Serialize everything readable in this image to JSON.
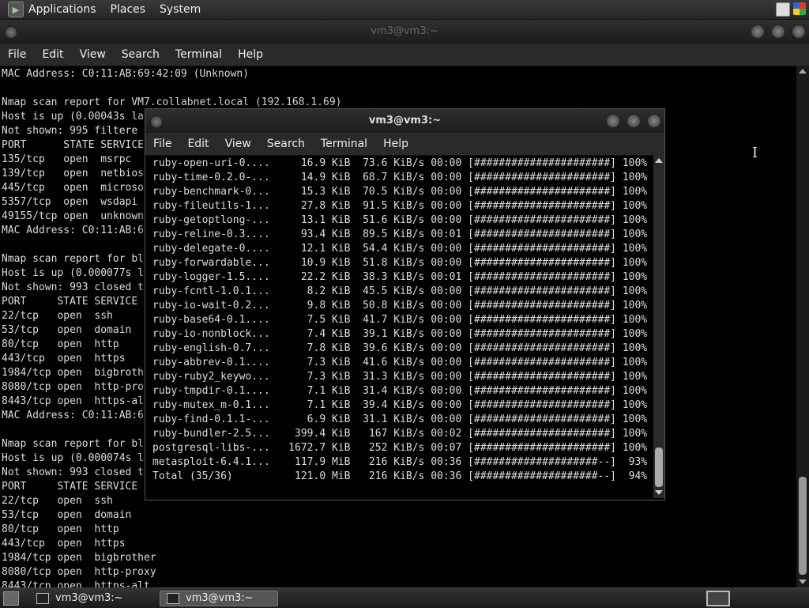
{
  "top_panel": {
    "menus": [
      "Applications",
      "Places",
      "System"
    ]
  },
  "back_window": {
    "title": "vm3@vm3:~",
    "menu": [
      "File",
      "Edit",
      "View",
      "Search",
      "Terminal",
      "Help"
    ],
    "lines": [
      "MAC Address: C0:11:AB:69:42:09 (Unknown)",
      "",
      "Nmap scan report for VM7.collabnet.local (192.168.1.69)",
      "Host is up (0.00043s la",
      "Not shown: 995 filtere",
      "PORT      STATE SERVICE",
      "135/tcp   open  msrpc",
      "139/tcp   open  netbios",
      "445/tcp   open  microso",
      "5357/tcp  open  wsdapi",
      "49155/tcp open  unknown",
      "MAC Address: C0:11:AB:6",
      "",
      "Nmap scan report for bl",
      "Host is up (0.000077s l",
      "Not shown: 993 closed t",
      "PORT     STATE SERVICE",
      "22/tcp   open  ssh",
      "53/tcp   open  domain",
      "80/tcp   open  http",
      "443/tcp  open  https",
      "1984/tcp open  bigbroth",
      "8080/tcp open  http-pro",
      "8443/tcp open  https-al",
      "MAC Address: C0:11:AB:6",
      "",
      "Nmap scan report for bl",
      "Host is up (0.000074s l",
      "Not shown: 993 closed t",
      "PORT     STATE SERVICE",
      "22/tcp   open  ssh",
      "53/tcp   open  domain",
      "80/tcp   open  http",
      "443/tcp  open  https",
      "1984/tcp open  bigbrother",
      "8080/tcp open  http-proxy",
      "8443/tcp open  https-alt"
    ]
  },
  "front_window": {
    "title": "vm3@vm3:~",
    "menu": [
      "File",
      "Edit",
      "View",
      "Search",
      "Terminal",
      "Help"
    ],
    "lines": [
      "ruby-open-uri-0....     16.9 KiB  73.6 KiB/s 00:00 [######################] 100%",
      "ruby-time-0.2.0-...     14.9 KiB  68.7 KiB/s 00:00 [######################] 100%",
      "ruby-benchmark-0...     15.3 KiB  70.5 KiB/s 00:00 [######################] 100%",
      "ruby-fileutils-1...     27.8 KiB  91.5 KiB/s 00:00 [######################] 100%",
      "ruby-getoptlong-...     13.1 KiB  51.6 KiB/s 00:00 [######################] 100%",
      "ruby-reline-0.3....     93.4 KiB  89.5 KiB/s 00:01 [######################] 100%",
      "ruby-delegate-0....     12.1 KiB  54.4 KiB/s 00:00 [######################] 100%",
      "ruby-forwardable...     10.9 KiB  51.8 KiB/s 00:00 [######################] 100%",
      "ruby-logger-1.5....     22.2 KiB  38.3 KiB/s 00:01 [######################] 100%",
      "ruby-fcntl-1.0.1...      8.2 KiB  45.5 KiB/s 00:00 [######################] 100%",
      "ruby-io-wait-0.2...      9.8 KiB  50.8 KiB/s 00:00 [######################] 100%",
      "ruby-base64-0.1....      7.5 KiB  41.7 KiB/s 00:00 [######################] 100%",
      "ruby-io-nonblock...      7.4 KiB  39.1 KiB/s 00:00 [######################] 100%",
      "ruby-english-0.7...      7.8 KiB  39.6 KiB/s 00:00 [######################] 100%",
      "ruby-abbrev-0.1....      7.3 KiB  41.6 KiB/s 00:00 [######################] 100%",
      "ruby-ruby2_keywo...      7.3 KiB  31.3 KiB/s 00:00 [######################] 100%",
      "ruby-tmpdir-0.1....      7.1 KiB  31.4 KiB/s 00:00 [######################] 100%",
      "ruby-mutex_m-0.1...      7.1 KiB  39.4 KiB/s 00:00 [######################] 100%",
      "ruby-find-0.1.1-...      6.9 KiB  31.1 KiB/s 00:00 [######################] 100%",
      "ruby-bundler-2.5...    399.4 KiB   167 KiB/s 00:02 [######################] 100%",
      "postgresql-libs-...   1672.7 KiB   252 KiB/s 00:07 [######################] 100%",
      "metasploit-6.4.1...    117.9 MiB   216 KiB/s 00:36 [####################--]  93%",
      "Total (35/36)          121.0 MiB   216 KiB/s 00:36 [####################--]  94%"
    ]
  },
  "taskbar": {
    "tasks": [
      {
        "label": "vm3@vm3:~",
        "active": false
      },
      {
        "label": "vm3@vm3:~",
        "active": true
      }
    ]
  },
  "icons": {
    "app_menu": "terminal-app-icon",
    "window_controls": [
      "minimize-icon",
      "maximize-icon",
      "close-icon"
    ]
  }
}
